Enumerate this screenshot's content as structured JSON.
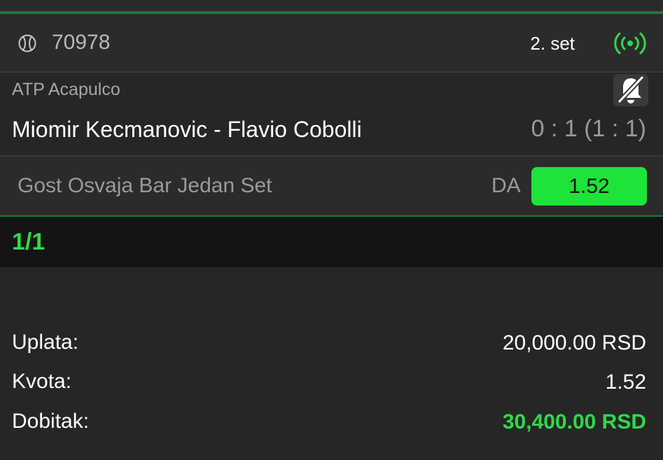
{
  "event": {
    "match_id": "70978",
    "period": "2. set",
    "league": "ATP Acapulco",
    "teams": "Miomir Kecmanovic - Flavio Cobolli",
    "score": "0 : 1 (1 : 1)"
  },
  "selection": {
    "market": "Gost Osvaja Bar Jedan Set",
    "pick": "DA",
    "odd": "1.52"
  },
  "ticket": {
    "count": "1/1"
  },
  "summary": {
    "stake_label": "Uplata:",
    "stake_value": "20,000.00 RSD",
    "odds_label": "Kvota:",
    "odds_value": "1.52",
    "win_label": "Dobitak:",
    "win_value": "30,400.00 RSD"
  },
  "colors": {
    "accent_green": "#1ee43a",
    "background": "#262626"
  },
  "icons": {
    "sport": "tennis-ball-icon",
    "live": "live-broadcast-icon",
    "notifications": "bell-off-icon"
  }
}
